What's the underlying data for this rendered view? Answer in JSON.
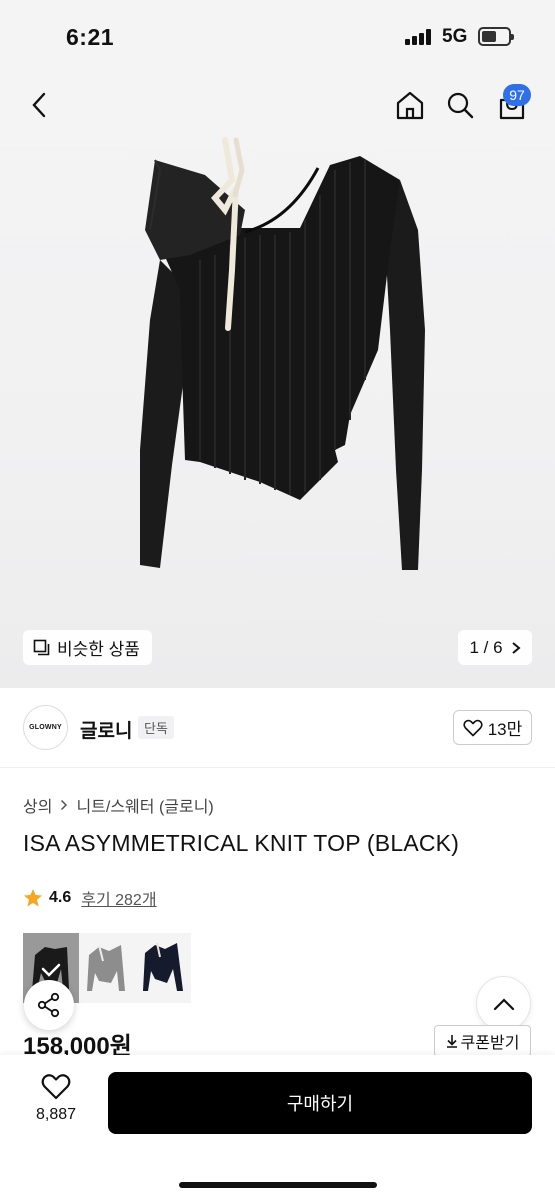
{
  "status_bar": {
    "time": "6:21",
    "network": "5G"
  },
  "header": {
    "cart_count": "97"
  },
  "hero": {
    "similar_label": "비슷한 상품",
    "counter": "1 / 6"
  },
  "brand": {
    "logo_text": "GLOWNY",
    "name": "글로니",
    "tag": "단독",
    "likes": "13만"
  },
  "product": {
    "breadcrumb": [
      "상의",
      "니트/스웨터 (글로니)"
    ],
    "title": "ISA ASYMMETRICAL KNIT TOP (BLACK)",
    "rating": "4.6",
    "reviews": "후기 282개",
    "price": "158,000원",
    "coupon_label": "쿠폰받기",
    "color_options": [
      "black",
      "gray",
      "navy"
    ]
  },
  "bottom": {
    "wish_count": "8,887",
    "buy_label": "구매하기"
  },
  "colors": {
    "accent": "#2f6fe8",
    "star": "#f5a623",
    "buy_button": "#000000"
  }
}
